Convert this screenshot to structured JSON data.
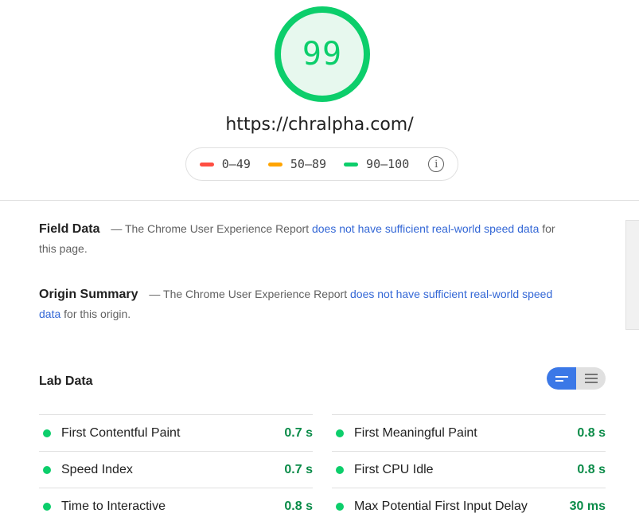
{
  "score": {
    "value": "99",
    "color": "#0cce6b"
  },
  "url": "https://chralpha.com/",
  "legend": {
    "items": [
      {
        "label": "0–49",
        "color": "#ff4e42"
      },
      {
        "label": "50–89",
        "color": "#ffa400"
      },
      {
        "label": "90–100",
        "color": "#0cce6b"
      }
    ],
    "info_icon": "info-icon"
  },
  "field_data": {
    "title": "Field Data",
    "prefix": " — The Chrome User Experience Report ",
    "link": "does not have sufficient real-world speed data",
    "suffix": " for this page."
  },
  "origin_summary": {
    "title": "Origin Summary",
    "prefix": " — The Chrome User Experience Report ",
    "link": "does not have sufficient real-world speed data",
    "suffix": " for this origin."
  },
  "lab_data": {
    "title": "Lab Data",
    "toggle": {
      "left_icon": "bars-condensed-icon",
      "right_icon": "bars-expanded-icon"
    },
    "metrics": [
      {
        "label": "First Contentful Paint",
        "value": "0.7 s"
      },
      {
        "label": "First Meaningful Paint",
        "value": "0.8 s"
      },
      {
        "label": "Speed Index",
        "value": "0.7 s"
      },
      {
        "label": "First CPU Idle",
        "value": "0.8 s"
      },
      {
        "label": "Time to Interactive",
        "value": "0.8 s"
      },
      {
        "label": "Max Potential First Input Delay",
        "value": "30 ms"
      }
    ]
  }
}
